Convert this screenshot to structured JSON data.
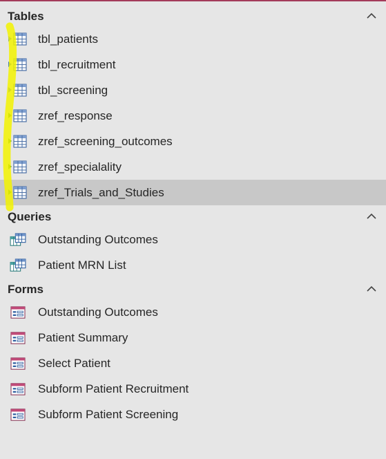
{
  "nav": {
    "sections": {
      "tables": {
        "title": "Tables",
        "items": [
          {
            "label": "tbl_patients",
            "linked_color": "#2f6fc4"
          },
          {
            "label": "tbl_recruitment",
            "linked_color": "#2f6fc4"
          },
          {
            "label": "tbl_screening",
            "linked_color": "#2f6fc4"
          },
          {
            "label": "zref_response",
            "linked_color": "#3a8a2a"
          },
          {
            "label": "zref_screening_outcomes",
            "linked_color": "#3a8a2a"
          },
          {
            "label": "zref_specialality",
            "linked_color": "#3a8a2a"
          },
          {
            "label": "zref_Trials_and_Studies",
            "linked_color": "#3a8a2a"
          }
        ]
      },
      "queries": {
        "title": "Queries",
        "items": [
          {
            "label": "Outstanding Outcomes"
          },
          {
            "label": "Patient MRN List"
          }
        ]
      },
      "forms": {
        "title": "Forms",
        "items": [
          {
            "label": "Outstanding Outcomes"
          },
          {
            "label": "Patient Summary"
          },
          {
            "label": "Select Patient"
          },
          {
            "label": "Subform Patient Recruitment"
          },
          {
            "label": "Subform Patient Screening"
          }
        ]
      }
    },
    "selected_item": "zref_Trials_and_Studies",
    "colors": {
      "background": "#e6e6e6",
      "selected_row": "#c8c8c8",
      "highlighter": "#f2f200",
      "accent_rule": "#a33b5a"
    }
  }
}
